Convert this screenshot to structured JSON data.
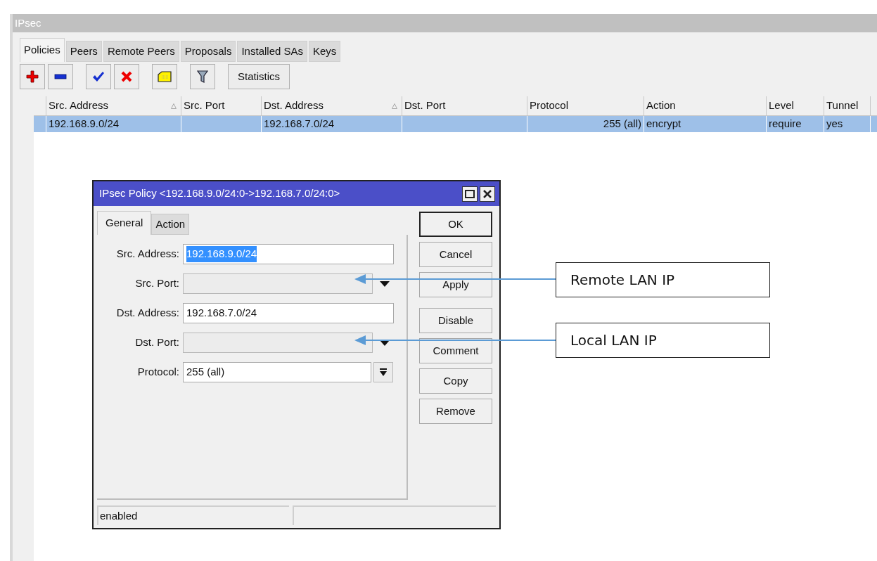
{
  "window": {
    "title": "IPsec"
  },
  "tabs": [
    {
      "label": "Policies",
      "selected": true
    },
    {
      "label": "Peers",
      "selected": false
    },
    {
      "label": "Remote Peers",
      "selected": false
    },
    {
      "label": "Proposals",
      "selected": false
    },
    {
      "label": "Installed SAs",
      "selected": false
    },
    {
      "label": "Keys",
      "selected": false
    }
  ],
  "toolbar": {
    "statistics_button": "Statistics"
  },
  "table": {
    "columns": [
      {
        "label": "Src. Address",
        "sorted": true
      },
      {
        "label": "Src. Port",
        "sorted": false
      },
      {
        "label": "Dst. Address",
        "sorted": true
      },
      {
        "label": "Dst. Port",
        "sorted": false
      },
      {
        "label": "Protocol",
        "sorted": false
      },
      {
        "label": "Action",
        "sorted": false
      },
      {
        "label": "Level",
        "sorted": false
      },
      {
        "label": "Tunnel",
        "sorted": false
      }
    ],
    "rows": [
      {
        "selected": true,
        "cells": [
          "192.168.9.0/24",
          "",
          "192.168.7.0/24",
          "",
          "255 (all)",
          "encrypt",
          "require",
          "yes"
        ]
      }
    ]
  },
  "dialog": {
    "title": "IPsec Policy <192.168.9.0/24:0->192.168.7.0/24:0>",
    "tabs": [
      {
        "label": "General",
        "selected": true
      },
      {
        "label": "Action",
        "selected": false
      }
    ],
    "fields": [
      {
        "label": "Src. Address:",
        "kind": "text",
        "value": "192.168.9.0/24",
        "highlighted": true
      },
      {
        "label": "Src. Port:",
        "kind": "dropdown"
      },
      {
        "label": "Dst. Address:",
        "kind": "text",
        "value": "192.168.7.0/24",
        "highlighted": false
      },
      {
        "label": "Dst. Port:",
        "kind": "dropdown"
      },
      {
        "label": "Protocol:",
        "kind": "combo",
        "value": "255 (all)"
      }
    ],
    "buttons": [
      {
        "label": "OK",
        "default": true
      },
      {
        "label": "Cancel",
        "default": false
      },
      {
        "label": "Apply",
        "default": false
      },
      {
        "label": "Disable",
        "default": false
      },
      {
        "label": "Comment",
        "default": false
      },
      {
        "label": "Copy",
        "default": false
      },
      {
        "label": "Remove",
        "default": false
      }
    ],
    "status": "enabled"
  },
  "callouts": [
    {
      "text": "Remote LAN IP"
    },
    {
      "text": "Local LAN IP"
    }
  ]
}
